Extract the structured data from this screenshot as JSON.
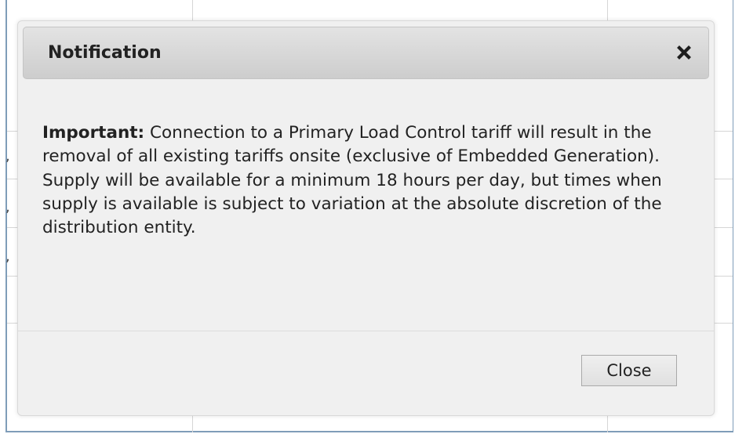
{
  "modal": {
    "title": "Notification",
    "close_icon": "close-x-icon",
    "body_strong": "Important:",
    "body_text": " Connection to a Primary Load Control tariff will result in the removal of all existing tariffs onsite (exclusive of Embedded Generation). Supply will be available for a minimum 18 hours per day, but times when supply is available is subject to variation at the absolute discretion of the distribution entity.",
    "close_button_label": "Close"
  },
  "background": {
    "glyphs": [
      ",",
      ",",
      ","
    ]
  }
}
